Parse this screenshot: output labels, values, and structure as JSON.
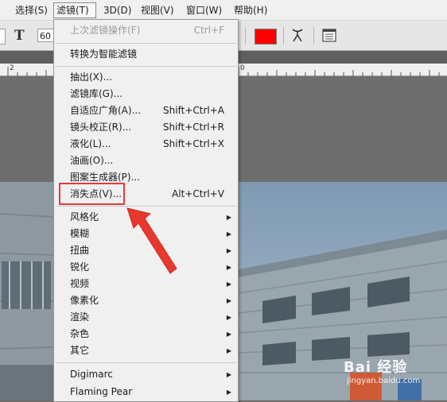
{
  "menubar": {
    "items": [
      "选择(S)",
      "滤镜(T)",
      "3D(D)",
      "视图(V)",
      "窗口(W)",
      "帮助(H)"
    ]
  },
  "options": {
    "font_size": "60",
    "text_color": "#ff0000"
  },
  "ruler": {
    "labels": [
      "2",
      "0"
    ]
  },
  "filter_menu": {
    "items": [
      {
        "label": "上次滤镜操作(F)",
        "shortcut": "Ctrl+F"
      },
      {
        "label": "转换为智能滤镜"
      },
      {
        "label": "抽出(X)..."
      },
      {
        "label": "滤镜库(G)..."
      },
      {
        "label": "自适应广角(A)...",
        "shortcut": "Shift+Ctrl+A"
      },
      {
        "label": "镜头校正(R)...",
        "shortcut": "Shift+Ctrl+R"
      },
      {
        "label": "液化(L)...",
        "shortcut": "Shift+Ctrl+X"
      },
      {
        "label": "油画(O)..."
      },
      {
        "label": "图案生成器(P)..."
      },
      {
        "label": "消失点(V)...",
        "shortcut": "Alt+Ctrl+V"
      },
      {
        "label": "风格化"
      },
      {
        "label": "模糊"
      },
      {
        "label": "扭曲"
      },
      {
        "label": "锐化"
      },
      {
        "label": "视频"
      },
      {
        "label": "像素化"
      },
      {
        "label": "渲染"
      },
      {
        "label": "杂色"
      },
      {
        "label": "其它"
      },
      {
        "label": "Digimarc"
      },
      {
        "label": "Flaming Pear"
      }
    ]
  },
  "watermark": {
    "brand": "Bai 经验",
    "url": "jingyan.baidu.com"
  },
  "colors": {
    "highlight": "#e23b3b",
    "accent_red": "#ff0000"
  }
}
